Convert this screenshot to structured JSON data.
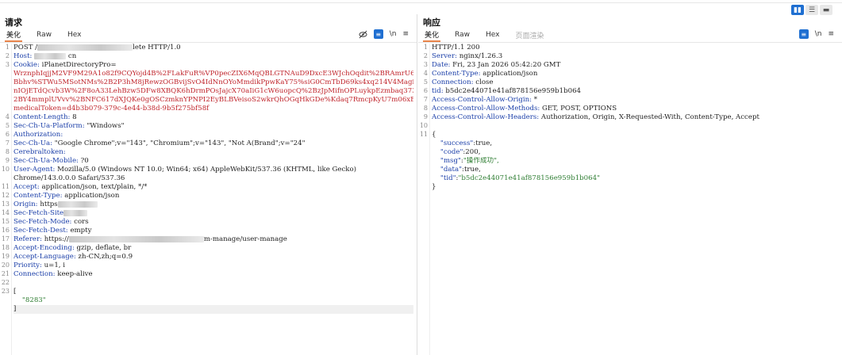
{
  "layout_toggle": [
    "split-horizontal",
    "split-vertical",
    "single"
  ],
  "request": {
    "title": "请求",
    "tabs": [
      {
        "label": "美化",
        "active": true
      },
      {
        "label": "Raw",
        "active": false
      },
      {
        "label": "Hex",
        "active": false
      }
    ],
    "tools": {
      "newline": "\\n",
      "menu": "≡"
    },
    "lines": [
      {
        "n": "1",
        "text": "POST /",
        "tail": "lete HTTP/1.0"
      },
      {
        "n": "2",
        "key": "Host:",
        "val": " ",
        "tail": " cn"
      },
      {
        "n": "3",
        "key": "Cookie:",
        "val": " iPlanetDirectoryPro="
      },
      {
        "n": "",
        "red": "WrznphIqjjM2VF9M29A1o82f9CQYojd4B%2FLakFuR%VP0pecZIX6MqQBLGTNAuD9DxcE3WJchOqdit%2BRAmrU6%2F6sFL%2"
      },
      {
        "n": "",
        "red": "Bbhv%STWu5MSotNMs%2B2P3hM8jRewzOGBvijSvO4IdNnOYoMmdikPpwKaY75%siG0CmTbD69ks4xq214V4MagipMS%2Fw9fNc"
      },
      {
        "n": "",
        "red": "nIOjETdQcvb3W%2F8oA33LehBzw5DFw8XBQK6hDrmPOsJajcX70aIiG1cW6uopcQ%2BzJpMifnOPLuykpEzmbaq37300SyD7%"
      },
      {
        "n": "",
        "red": "2BY4mmplUVvv%2BNFC617dXJQKe0gOSCzmknYPNPI2EyBLBVeisoS2wkrQhOGqHkGDe%Kdaq7RmcpKyU7m06xEp94%3D;"
      },
      {
        "n": "",
        "red": "medicalToken=d4b3b079-379c-4e44-b38d-9b5f275bf58f"
      },
      {
        "n": "4",
        "key": "Content-Length:",
        "val": " 8"
      },
      {
        "n": "5",
        "key": "Sec-Ch-Ua-Platform:",
        "val": " \"Windows\""
      },
      {
        "n": "6",
        "key": "Authorization:",
        "val": ""
      },
      {
        "n": "7",
        "key": "Sec-Ch-Ua:",
        "val": " \"Google Chrome\";v=\"143\", \"Chromium\";v=\"143\", \"Not A(Brand\";v=\"24\""
      },
      {
        "n": "8",
        "key": "Cerebraltoken:",
        "val": ""
      },
      {
        "n": "9",
        "key": "Sec-Ch-Ua-Mobile:",
        "val": " ?0"
      },
      {
        "n": "10",
        "key": "User-Agent:",
        "val": " Mozilla/5.0 (Windows NT 10.0; Win64; x64) AppleWebKit/537.36 (KHTML, like Gecko)"
      },
      {
        "n": "",
        "plain": "Chrome/143.0.0.0 Safari/537.36"
      },
      {
        "n": "11",
        "key": "Accept:",
        "val": " application/json, text/plain, */*"
      },
      {
        "n": "12",
        "key": "Content-Type:",
        "val": " application/json"
      },
      {
        "n": "13",
        "key": "Origin:",
        "val": " https"
      },
      {
        "n": "14",
        "key": "Sec-Fetch-Site",
        "val": ""
      },
      {
        "n": "15",
        "key": "Sec-Fetch-Mode:",
        "val": " cors"
      },
      {
        "n": "16",
        "key": "Sec-Fetch-Dest:",
        "val": " empty"
      },
      {
        "n": "17",
        "key": "Referer:",
        "val": " https://",
        "tail": "m-manage/user-manage"
      },
      {
        "n": "18",
        "key": "Accept-Encoding:",
        "val": " gzip, deflate, br"
      },
      {
        "n": "19",
        "key": "Accept-Language:",
        "val": " zh-CN,zh;q=0.9"
      },
      {
        "n": "20",
        "key": "Priority:",
        "val": " u=1, i"
      },
      {
        "n": "21",
        "key": "Connection:",
        "val": " keep-alive"
      },
      {
        "n": "22",
        "plain": ""
      },
      {
        "n": "23",
        "plain": "["
      },
      {
        "n": "",
        "str": "    \"8283\""
      },
      {
        "n": "",
        "plain": "]"
      }
    ]
  },
  "response": {
    "title": "响应",
    "tabs": [
      {
        "label": "美化",
        "active": true
      },
      {
        "label": "Raw",
        "active": false
      },
      {
        "label": "Hex",
        "active": false
      },
      {
        "label": "页面渲染",
        "active": false,
        "disabled": true
      }
    ],
    "tools": {
      "newline": "\\n",
      "menu": "≡"
    },
    "lines": [
      {
        "n": "1",
        "plain": "HTTP/1.1 200"
      },
      {
        "n": "2",
        "key": "Server:",
        "val": " nginx/1.26.3"
      },
      {
        "n": "3",
        "key": "Date:",
        "val": " Fri, 23 Jan 2026 05:42:20 GMT"
      },
      {
        "n": "4",
        "key": "Content-Type:",
        "val": " application/json"
      },
      {
        "n": "5",
        "key": "Connection:",
        "val": " close"
      },
      {
        "n": "6",
        "key": "tid:",
        "val": " b5dc2e44071e41af878156e959b1b064"
      },
      {
        "n": "7",
        "key": "Access-Control-Allow-Origin:",
        "val": " *"
      },
      {
        "n": "8",
        "key": "Access-Control-Allow-Methods:",
        "val": " GET, POST, OPTIONS"
      },
      {
        "n": "9",
        "key": "Access-Control-Allow-Headers:",
        "val": " Authorization, Origin, X-Requested-With, Content-Type, Accept"
      },
      {
        "n": "10",
        "plain": ""
      },
      {
        "n": "11",
        "plain": "{"
      },
      {
        "n": "",
        "jk": "    \"success\"",
        "jv": ":true,"
      },
      {
        "n": "",
        "jk": "    \"code\"",
        "jv": ":200,"
      },
      {
        "n": "",
        "jk": "    \"msg\"",
        "jv": ":",
        "js": "\"操作成功\","
      },
      {
        "n": "",
        "jk": "    \"data\"",
        "jv": ":true,"
      },
      {
        "n": "",
        "jk": "    \"tid\"",
        "jv": ":",
        "js": "\"b5dc2e44071e41af878156e959b1b064\""
      },
      {
        "n": "",
        "plain": "}"
      }
    ]
  }
}
